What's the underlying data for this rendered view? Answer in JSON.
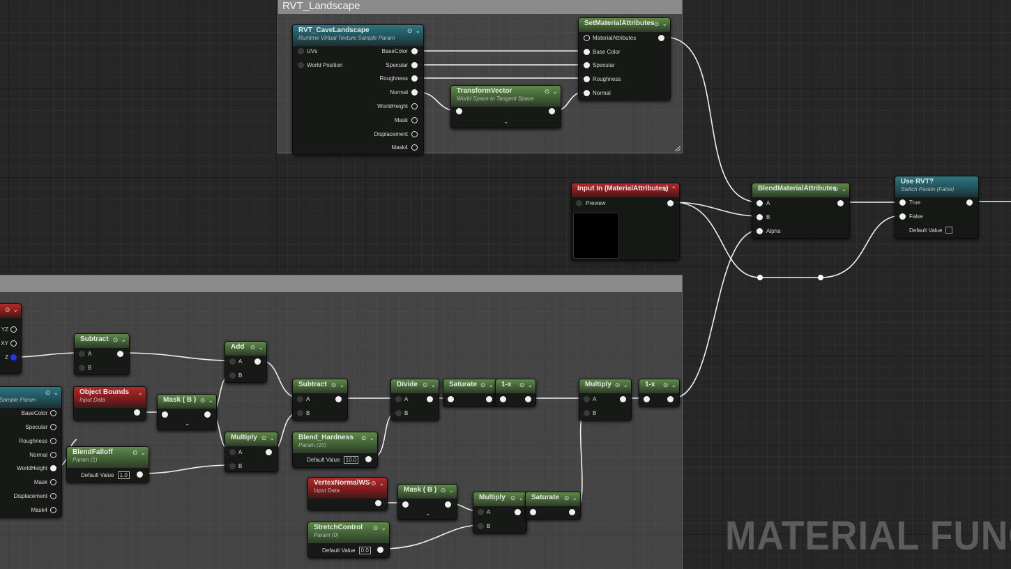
{
  "comments": {
    "top_title": "RVT_Landscape",
    "bottom_title": ""
  },
  "watermark": "MATERIAL FUNC",
  "controls": {
    "close": "⊙",
    "expand": "⌄",
    "collapse": "⌃",
    "expander": "⌄"
  },
  "nodes": {
    "rvt_sample": {
      "title": "RVT_CaveLandscape",
      "subtitle": "Runtime Virtual Texture Sample Param",
      "inputs": [
        "UVs",
        "World Position"
      ],
      "outputs": [
        "BaseColor",
        "Specular",
        "Roughness",
        "Normal",
        "WorldHeight",
        "Mask",
        "Displacement",
        "Mask4"
      ]
    },
    "transform_vector": {
      "title": "TransformVector",
      "subtitle": "World Space to Tangent Space"
    },
    "set_material_attributes": {
      "title": "SetMaterialAttributes",
      "inputs": [
        "MaterialAttributes",
        "Base Color",
        "Specular",
        "Roughness",
        "Normal"
      ]
    },
    "input_in": {
      "title": "Input In (MaterialAttributes)",
      "pin": "Preview"
    },
    "blend_material_attributes": {
      "title": "BlendMaterialAttributes",
      "inputs": [
        "A",
        "B",
        "Alpha"
      ]
    },
    "use_rvt": {
      "title": "Use RVT?",
      "subtitle": "Switch Param (False)",
      "inputs": [
        "True",
        "False"
      ],
      "default_label": "Default Value"
    },
    "partial_node": {
      "outputs": [
        "YZ",
        "XY",
        "Z"
      ]
    },
    "rvt_sample_2": {
      "subtitle": "Sample Param",
      "outputs": [
        "BaseColor",
        "Specular",
        "Roughness",
        "Normal",
        "WorldHeight",
        "Mask",
        "Displacement",
        "Mask4"
      ]
    },
    "subtract_1": {
      "title": "Subtract",
      "inputs": [
        "A",
        "B"
      ]
    },
    "add": {
      "title": "Add",
      "inputs": [
        "A",
        "B"
      ]
    },
    "object_bounds": {
      "title": "Object Bounds",
      "subtitle": "Input Data"
    },
    "mask_b_1": {
      "title": "Mask ( B )"
    },
    "blend_falloff": {
      "title": "BlendFalloff",
      "subtitle": "Param (1)",
      "default_label": "Default Value",
      "default_value": "1.0"
    },
    "multiply_1": {
      "title": "Multiply",
      "inputs": [
        "A",
        "B"
      ]
    },
    "subtract_2": {
      "title": "Subtract",
      "inputs": [
        "A",
        "B"
      ]
    },
    "blend_hardness": {
      "title": "Blend_Hardness",
      "subtitle": "Param (10)",
      "default_label": "Default Value",
      "default_value": "10.0"
    },
    "divide": {
      "title": "Divide",
      "inputs": [
        "A",
        "B"
      ]
    },
    "saturate_1": {
      "title": "Saturate"
    },
    "one_minus_1": {
      "title": "1-x"
    },
    "multiply_2": {
      "title": "Multiply",
      "inputs": [
        "A",
        "B"
      ]
    },
    "one_minus_2": {
      "title": "1-x"
    },
    "vertex_normal": {
      "title": "VertexNormalWS",
      "subtitle": "Input Data"
    },
    "mask_b_2": {
      "title": "Mask ( B )"
    },
    "multiply_3": {
      "title": "Multiply",
      "inputs": [
        "A",
        "B"
      ]
    },
    "saturate_2": {
      "title": "Saturate"
    },
    "stretch_control": {
      "title": "StretchControl",
      "subtitle": "Param (0)",
      "default_label": "Default Value",
      "default_value": "0.0"
    }
  }
}
